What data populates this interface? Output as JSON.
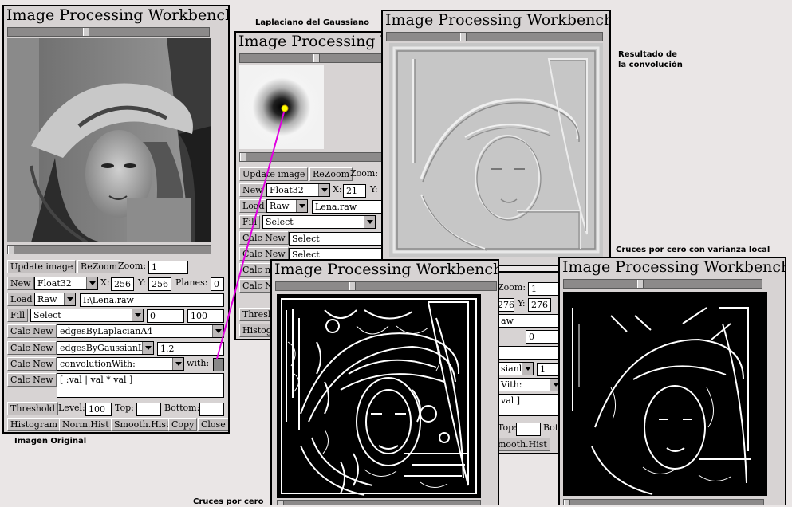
{
  "window_title": "Image Processing Workbench",
  "captions": {
    "laplacian": "Laplaciano del Gaussiano",
    "result_line1": "Resultado de",
    "result_line2": "la convolución",
    "zero_var": "Cruces por cero con varianza local",
    "original": "Imagen Original",
    "zero": "Cruces por cero"
  },
  "main": {
    "update_image": "Update image",
    "rezoom": "ReZoom",
    "zoom_label": "Zoom:",
    "zoom_value": "1",
    "new_label": "New",
    "new_type": "Float32",
    "x_label": "X:",
    "x_value": "256",
    "y_label": "Y:",
    "y_value": "256",
    "planes_label": "Planes:",
    "planes_value": "0",
    "load_label": "Load",
    "load_format": "Raw",
    "load_file": "I:\\Lena.raw",
    "fill_label": "Fill",
    "fill_select": "Select",
    "fill_from": "0",
    "fill_to": "100",
    "calc_new": "Calc New",
    "calc1": "edgesByLaplacianA4",
    "calc2": "edgesByGaussianL",
    "calc2_value": "1.2",
    "calc3": "convolutionWith:",
    "with_label": "with:",
    "calc4_label": "Calc New",
    "block_text": "[ :val | val * val ]",
    "threshold": "Threshold",
    "level_label": "Level:",
    "level_value": "100",
    "top_label": "Top:",
    "bottom_label": "Bottom:",
    "histogram": "Histogram",
    "norm_hist": "Norm.Hist",
    "smooth_hist": "Smooth.Hist",
    "copy": "Copy",
    "close": "Close"
  },
  "laplacian_win": {
    "update_image": "Update image",
    "rezoom": "ReZoom",
    "zoom_label": "Zoom:",
    "new_label": "New",
    "new_type": "Float32",
    "x_label": "X:",
    "x_value": "21",
    "y_label": "Y:",
    "load_label": "Load",
    "load_format": "Raw",
    "load_file": "Lena.raw",
    "fill_label": "Fill",
    "fill_select": "Select",
    "calc_new": "Calc New",
    "calc_select": "Select",
    "calc_partial": "Calc n",
    "calc_partial2": "Calc Ne",
    "threshold_partial": "Thresh",
    "histogram_partial": "Histogra"
  },
  "zv_partial": {
    "zoom_label": "Zoom:",
    "zoom_value": "1",
    "x_value": "276",
    "y_label": "Y:",
    "y_value": "276",
    "file_partial": "aw",
    "fill_value": "0",
    "calc_partial": "sianl",
    "calc_value": "1",
    "with_partial": "Vith:",
    "block_partial": "val ]",
    "top_partial": "Top:",
    "bottom_partial": "Bott",
    "smooth_partial": "mooth.Hist",
    "copy_partial": "Co"
  }
}
